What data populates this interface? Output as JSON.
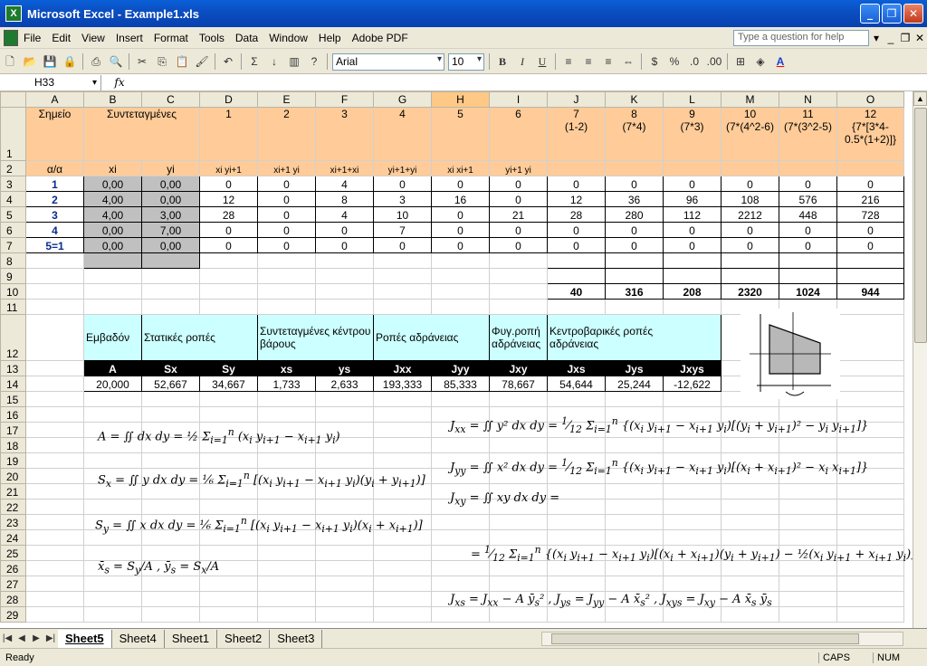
{
  "window": {
    "title": "Microsoft Excel - Example1.xls",
    "app_icon": "X"
  },
  "menu": {
    "items": [
      "File",
      "Edit",
      "View",
      "Insert",
      "Format",
      "Tools",
      "Data",
      "Window",
      "Help",
      "Adobe PDF"
    ],
    "help_placeholder": "Type a question for help"
  },
  "toolbar": {
    "font": "Arial",
    "size": "10",
    "bold": "B",
    "italic": "I",
    "underline": "U",
    "sigma": "Σ",
    "percent": "%"
  },
  "formula": {
    "namebox": "H33",
    "fx": "fx",
    "value": ""
  },
  "columns": [
    "A",
    "B",
    "C",
    "D",
    "E",
    "F",
    "G",
    "H",
    "I",
    "J",
    "K",
    "L",
    "M",
    "N",
    "O"
  ],
  "row1": {
    "A": "Σημείο",
    "BC": "Συντεταγμένες",
    "D": "1",
    "E": "2",
    "F": "3",
    "G": "4",
    "H": "5",
    "I": "6",
    "J": [
      "7",
      "(1-2)"
    ],
    "K": [
      "8",
      "(7*4)"
    ],
    "L": [
      "9",
      "(7*3)"
    ],
    "M": [
      "10",
      "(7*(4^2-6)"
    ],
    "N": [
      "11",
      "(7*(3^2-5)"
    ],
    "O": [
      "12",
      "{7*[3*4-",
      "0.5*(1+2)]}"
    ]
  },
  "row2": {
    "A": "α/α",
    "B": "xi",
    "C": "yi",
    "D": "xi yi+1",
    "E": "xi+1 yi",
    "F": "xi+1+xi",
    "G": "yi+1+yi",
    "H": "xi xi+1",
    "I": "yi+1 yi"
  },
  "data_rows": [
    {
      "r": "3",
      "a": "1",
      "b": "0,00",
      "c": "0,00",
      "d": "0",
      "e": "0",
      "f": "4",
      "g": "0",
      "h": "0",
      "i": "0",
      "j": "0",
      "k": "0",
      "l": "0",
      "m": "0",
      "n": "0",
      "o": "0"
    },
    {
      "r": "4",
      "a": "2",
      "b": "4,00",
      "c": "0,00",
      "d": "12",
      "e": "0",
      "f": "8",
      "g": "3",
      "h": "16",
      "i": "0",
      "j": "12",
      "k": "36",
      "l": "96",
      "m": "108",
      "n": "576",
      "o": "216"
    },
    {
      "r": "5",
      "a": "3",
      "b": "4,00",
      "c": "3,00",
      "d": "28",
      "e": "0",
      "f": "4",
      "g": "10",
      "h": "0",
      "i": "21",
      "j": "28",
      "k": "280",
      "l": "112",
      "m": "2212",
      "n": "448",
      "o": "728"
    },
    {
      "r": "6",
      "a": "4",
      "b": "0,00",
      "c": "7,00",
      "d": "0",
      "e": "0",
      "f": "0",
      "g": "7",
      "h": "0",
      "i": "0",
      "j": "0",
      "k": "0",
      "l": "0",
      "m": "0",
      "n": "0",
      "o": "0"
    },
    {
      "r": "7",
      "a": "5=1",
      "b": "0,00",
      "c": "0,00",
      "d": "0",
      "e": "0",
      "f": "0",
      "g": "0",
      "h": "0",
      "i": "0",
      "j": "0",
      "k": "0",
      "l": "0",
      "m": "0",
      "n": "0",
      "o": "0"
    }
  ],
  "totals": {
    "j": "40",
    "k": "316",
    "l": "208",
    "m": "2320",
    "n": "1024",
    "o": "944"
  },
  "results": {
    "headers": [
      "Εμβαδόν",
      "Στατικές ροπές",
      "Συντεταγμένες κέντρου βάρους",
      "Ροπές αδράνειας",
      "Φυγ.ροπή αδράνειας",
      "Κεντροβαρικές ροπές αδράνειας"
    ],
    "symbols": [
      "A",
      "Sx",
      "Sy",
      "xs",
      "ys",
      "Jxx",
      "Jyy",
      "Jxy",
      "Jxs",
      "Jys",
      "Jxys"
    ],
    "values": [
      "20,000",
      "52,667",
      "34,667",
      "1,733",
      "2,633",
      "193,333",
      "85,333",
      "78,667",
      "54,644",
      "25,244",
      "-12,622"
    ]
  },
  "sheets": {
    "tabs": [
      "Sheet5",
      "Sheet4",
      "Sheet1",
      "Sheet2",
      "Sheet3"
    ],
    "active": "Sheet5"
  },
  "status": {
    "ready": "Ready",
    "caps": "CAPS",
    "num": "NUM"
  }
}
